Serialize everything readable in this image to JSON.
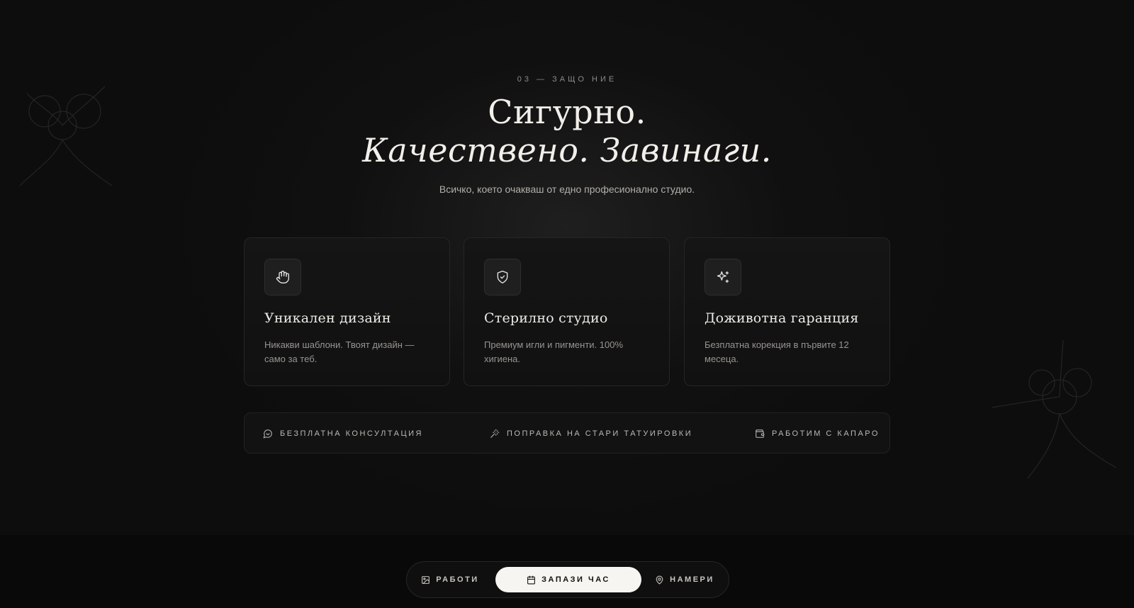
{
  "section": {
    "eyebrow": "03 — ЗАЩО НИЕ",
    "title_line1": "Сигурно.",
    "title_line2": "Качествено. Завинаги.",
    "subtitle": "Всичко, което очакваш от едно професионално студио."
  },
  "cards": [
    {
      "icon": "hand-icon",
      "title": "Уникален дизайн",
      "desc": "Никакви шаблони. Твоят дизайн — само за теб."
    },
    {
      "icon": "shield-check-icon",
      "title": "Стерилно студио",
      "desc": "Премиум игли и пигменти. 100% хигиена."
    },
    {
      "icon": "sparkles-icon",
      "title": "Доживотна гаранция",
      "desc": "Безплатна корекция в първите 12 месеца."
    }
  ],
  "features": [
    {
      "icon": "chat-icon",
      "label": "БЕЗПЛАТНА КОНСУЛТАЦИЯ"
    },
    {
      "icon": "magic-wand-icon",
      "label": "ПОПРАВКА НА СТАРИ ТАТУИРОВКИ"
    },
    {
      "icon": "wallet-icon",
      "label": "РАБОТИМ С КАПАРО"
    }
  ],
  "nav": {
    "works": "РАБОТИ",
    "book": "ЗАПАЗИ ЧАС",
    "find": "НАМЕРИ"
  },
  "colors": {
    "background": "#0b0b0b",
    "card": "#141414",
    "accent_button": "#f7f5f1",
    "text": "#e8e6e2",
    "muted": "#98948f"
  }
}
